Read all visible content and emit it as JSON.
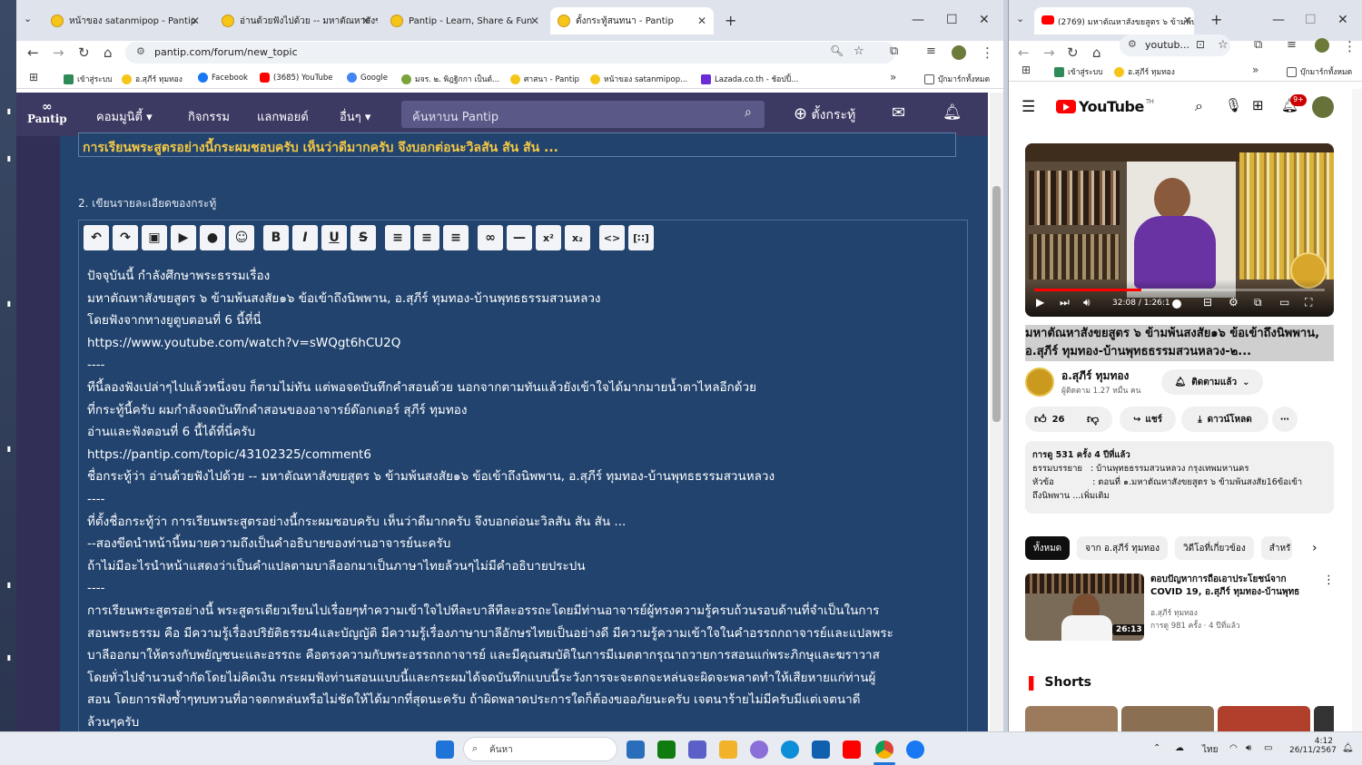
{
  "left_browser": {
    "tabs": [
      {
        "title": "หน้าของ satanmipop - Pantip",
        "active": false
      },
      {
        "title": "อ่านด้วยฟังไปด้วย -- มหาตัณหาสังขย",
        "active": false
      },
      {
        "title": "Pantip - Learn, Share & Fun",
        "active": false
      },
      {
        "title": "ตั้งกระทู้สนทนา - Pantip",
        "active": true
      }
    ],
    "url": "pantip.com/forum/new_topic",
    "bookmarks": [
      "เข้าสู่ระบบ",
      "อ.สุภีร์ ทุมทอง",
      "Facebook",
      "(3685) YouTube",
      "Google",
      "มจร. ๒. พิฎฐิกกา เป็นต์...",
      "ศาสนา - Pantip",
      "หน้าของ satanmipop...",
      "Lazada.co.th - ช้อปปิ้...",
      "บุ๊กมาร์กทั้งหมด"
    ]
  },
  "pantip": {
    "logo": "Pantip",
    "nav": [
      "คอมมูนิตี้",
      "กิจกรรม",
      "แลกพอยต์",
      "อื่นๆ"
    ],
    "search_placeholder": "ค้นหาบน Pantip",
    "new_topic_label": "ตั้งกระทู้",
    "topic_title": "การเรียนพระสูตรอย่างนี้กระผมชอบครับ เห็นว่าดีมากครับ จึงบอกต่อนะวิลสัน สัน สัน ...",
    "section_label": "2. เขียนรายละเอียดของกระทู้",
    "toolbar_buttons": [
      {
        "name": "undo",
        "glyph": "↶"
      },
      {
        "name": "redo",
        "glyph": "↷"
      },
      {
        "name": "image",
        "glyph": "▣"
      },
      {
        "name": "video",
        "glyph": "▶"
      },
      {
        "name": "location",
        "glyph": "●"
      },
      {
        "name": "emoji",
        "glyph": "☺"
      },
      {
        "name": "bold",
        "glyph": "B"
      },
      {
        "name": "italic",
        "glyph": "I"
      },
      {
        "name": "underline",
        "glyph": "U"
      },
      {
        "name": "strikethrough",
        "glyph": "S"
      },
      {
        "name": "align-left",
        "glyph": "≡"
      },
      {
        "name": "align-center",
        "glyph": "≡"
      },
      {
        "name": "align-right",
        "glyph": "≡"
      },
      {
        "name": "link",
        "glyph": "∞"
      },
      {
        "name": "horizontal-rule",
        "glyph": "—"
      },
      {
        "name": "superscript",
        "glyph": "x²"
      },
      {
        "name": "subscript",
        "glyph": "x₂"
      },
      {
        "name": "code",
        "glyph": "<>"
      },
      {
        "name": "spoiler",
        "glyph": "[∷]"
      }
    ],
    "body_lines": [
      "ปัจจุบันนี้ กำลังศึกษาพระธรรมเรื่อง",
      "มหาตัณหาสังขยสูตร ๖ ข้ามพ้นสงสัย๑๖ ข้อเข้าถึงนิพพาน, อ.สุภีร์ ทุมทอง-บ้านพุทธธรรมสวนหลวง",
      "โดยฟังจากทางยูตูบตอนที่ 6 นี้ที่นี่",
      "https://www.youtube.com/watch?v=sWQgt6hCU2Q",
      "----",
      "ทีนี้ลองฟังเปล่าๆไปแล้วหนึ่งจบ ก็ตามไม่ทัน แต่พอจดบันทึกคำสอนด้วย นอกจากตามทันแล้วยังเข้าใจได้มากมายน้ำตาไหลอีกด้วย",
      "ที่กระทู้นี้ครับ ผมกำลังจดบันทึกคำสอนของอาจารย์ด๊อกเตอร์ สุภีร์ ทุมทอง",
      "อ่านและฟังตอนที่ 6 นี้ได้ที่นี่ครับ",
      "https://pantip.com/topic/43102325/comment6",
      "ชื่อกระทู้ว่า อ่านด้วยฟังไปด้วย -- มหาตัณหาสังขยสูตร ๖ ข้ามพ้นสงสัย๑๖ ข้อเข้าถึงนิพพาน, อ.สุภีร์ ทุมทอง-บ้านพุทธธรรมสวนหลวง",
      "----",
      "ที่ตั้งชื่อกระทู้ว่า การเรียนพระสูตรอย่างนี้กระผมชอบครับ เห็นว่าดีมากครับ จึงบอกต่อนะวิลสัน สัน สัน ...",
      "--สองขีดนำหน้านี้หมายความถึงเป็นคำอธิบายของท่านอาจารย์นะครับ",
      "ถ้าไม่มีอะไรนำหน้าแสดงว่าเป็นคำแปลตามบาลีออกมาเป็นภาษาไทยล้วนๆไม่มีคำอธิบายประปน",
      "----",
      "การเรียนพระสูตรอย่างนี้ พระสูตรเดียวเรียนไปเรื่อยๆทำความเข้าใจไปทีละบาลีทีละอรรถะโดยมีท่านอาจารย์ผู้ทรงความรู้ครบถ้วนรอบด้านที่จำเป็นในการ",
      "สอนพระธรรม คือ มีความรู้เรื่องปริยัติธรรม4และบัญญัติ มีความรู้เรื่องภาษาบาลีอักษรไทยเป็นอย่างดี มีความรู้ความเข้าใจในคำอรรถกถาจารย์และแปลพระ",
      "บาลีออกมาให้ตรงกับพยัญชนะและอรรถะ คือตรงความกับพระอรรถกถาจารย์ และมีคุณสมบัติในการมีเมตตากรุณาถวายการสอนแก่พระภิกษุและฆราวาส",
      "โดยทั่วไปจำนวนจำกัดโดยไม่คิดเงิน กระผมฟังท่านสอนแบบนี้และกระผมได้จดบันทึกแบบนี้ระวังการจะจะตกจะหล่นจะผิดจะพลาดทำให้เสียหายแก่ท่านผู้",
      "สอน โดยการฟังซ้ำๆทบทวนที่อาจตกหล่นหรือไม่ชัดให้ได้มากที่สุดนะครับ ถ้าผิดพลาดประการใดก็ต้องขออภัยนะครับ เจตนาร้ายไม่มีครับมีแต่เจตนาดี",
      "ล้วนๆครับ"
    ]
  },
  "right_browser": {
    "tab_title": "(2769) มหาตัณหาสังขยสูตร ๖ ข้ามพ้น",
    "url": "youtub...",
    "bookmarks": [
      "เข้าสู่ระบบ",
      "อ.สุภีร์ ทุมทอง",
      "บุ๊กมาร์กทั้งหมด"
    ],
    "youtube_logo": "YouTube",
    "youtube_region": "TH",
    "notif_count": "9+",
    "video_time": "32:08 / 1:26:1",
    "video_progress": 0.37,
    "video_title": "มหาตัณหาสังขยสูตร ๖ ข้ามพ้นสงสัย๑๖ ข้อเข้าถึงนิพพาน, อ.สุภีร์ ทุมทอง-บ้านพุทธธรรมสวนหลวง-๒...",
    "channel_name": "อ.สุภีร์ ทุมทอง",
    "subscribers": "ผู้ติดตาม 1.27 หมื่น คน",
    "subscribe_label": "ติดตามแล้ว",
    "likes": "26",
    "share_label": "แชร์",
    "download_label": "ดาวน์โหลด",
    "desc_stats": "การดู 531 ครั้ง  4 ปีที่แล้ว",
    "desc_line1": "ธรรมบรรยาย   : บ้านพุทธธรรมสวนหลวง กรุงเทพมหานคร",
    "desc_line2": "หัวข้อ              : ตอนที่ ๑.มหาตัณหาสังขยสูตร ๖ ข้ามพ้นสงสัย16ข้อเข้า",
    "desc_line3": "ถึงนิพพาน ...เพิ่มเติม",
    "chips": [
      "ทั้งหมด",
      "จาก อ.สุภีร์ ทุมทอง",
      "วิดีโอที่เกี่ยวข้อง",
      "สำหรั"
    ],
    "rec_title": "ตอบปัญหาการถือเอาประโยชน์จาก COVID 19, อ.สุภีร์ ทุมทอง-บ้านพุทธธร...",
    "rec_channel": "อ.สุภีร์ ทุมทอง",
    "rec_meta": "การดู 981 ครั้ง · 4 ปีที่แล้ว",
    "rec_duration": "26:13",
    "shorts_label": "Shorts"
  },
  "taskbar": {
    "search_placeholder": "ค้นหา",
    "lang": "ไทย",
    "time": "4:12",
    "date": "26/11/2567"
  },
  "colors": {
    "pantip_nav": "#3c3963",
    "pantip_card": "#22446f",
    "topic_title": "#f2c744",
    "youtube_red": "#ff0000"
  }
}
